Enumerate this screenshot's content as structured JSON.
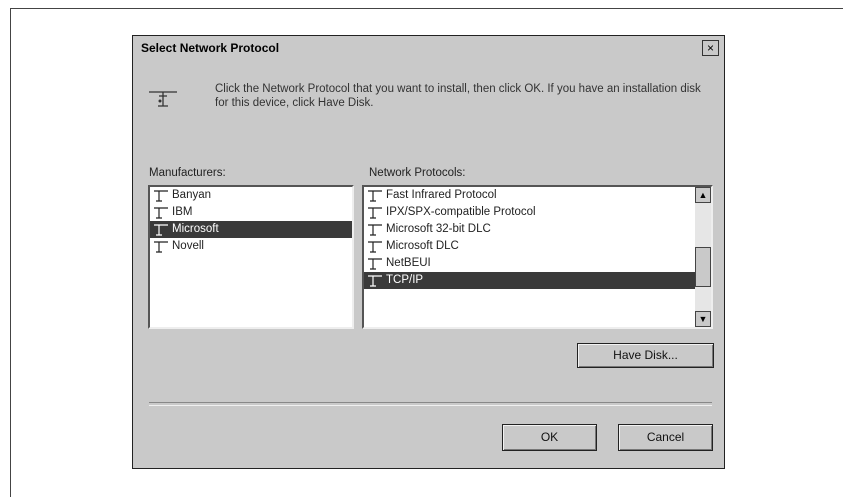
{
  "dialog": {
    "title": "Select Network Protocol",
    "close_glyph": "×",
    "instruction": "Click the Network Protocol that you want to install, then click OK. If you have an installation disk for this device, click Have Disk.",
    "icon": "network-protocol-icon"
  },
  "manufacturers": {
    "label": "Manufacturers:",
    "items": [
      {
        "label": "Banyan",
        "selected": false
      },
      {
        "label": "IBM",
        "selected": false
      },
      {
        "label": "Microsoft",
        "selected": true
      },
      {
        "label": "Novell",
        "selected": false
      }
    ]
  },
  "protocols": {
    "label": "Network Protocols:",
    "items": [
      {
        "label": "Fast Infrared Protocol",
        "selected": false
      },
      {
        "label": "IPX/SPX-compatible Protocol",
        "selected": false
      },
      {
        "label": "Microsoft 32-bit DLC",
        "selected": false
      },
      {
        "label": "Microsoft DLC",
        "selected": false
      },
      {
        "label": "NetBEUI",
        "selected": false
      },
      {
        "label": "TCP/IP",
        "selected": true
      }
    ]
  },
  "buttons": {
    "have_disk": "Have Disk...",
    "ok": "OK",
    "cancel": "Cancel"
  },
  "colors": {
    "dialog_bg": "#c9c9c9",
    "selection": "#3a3a3a"
  }
}
